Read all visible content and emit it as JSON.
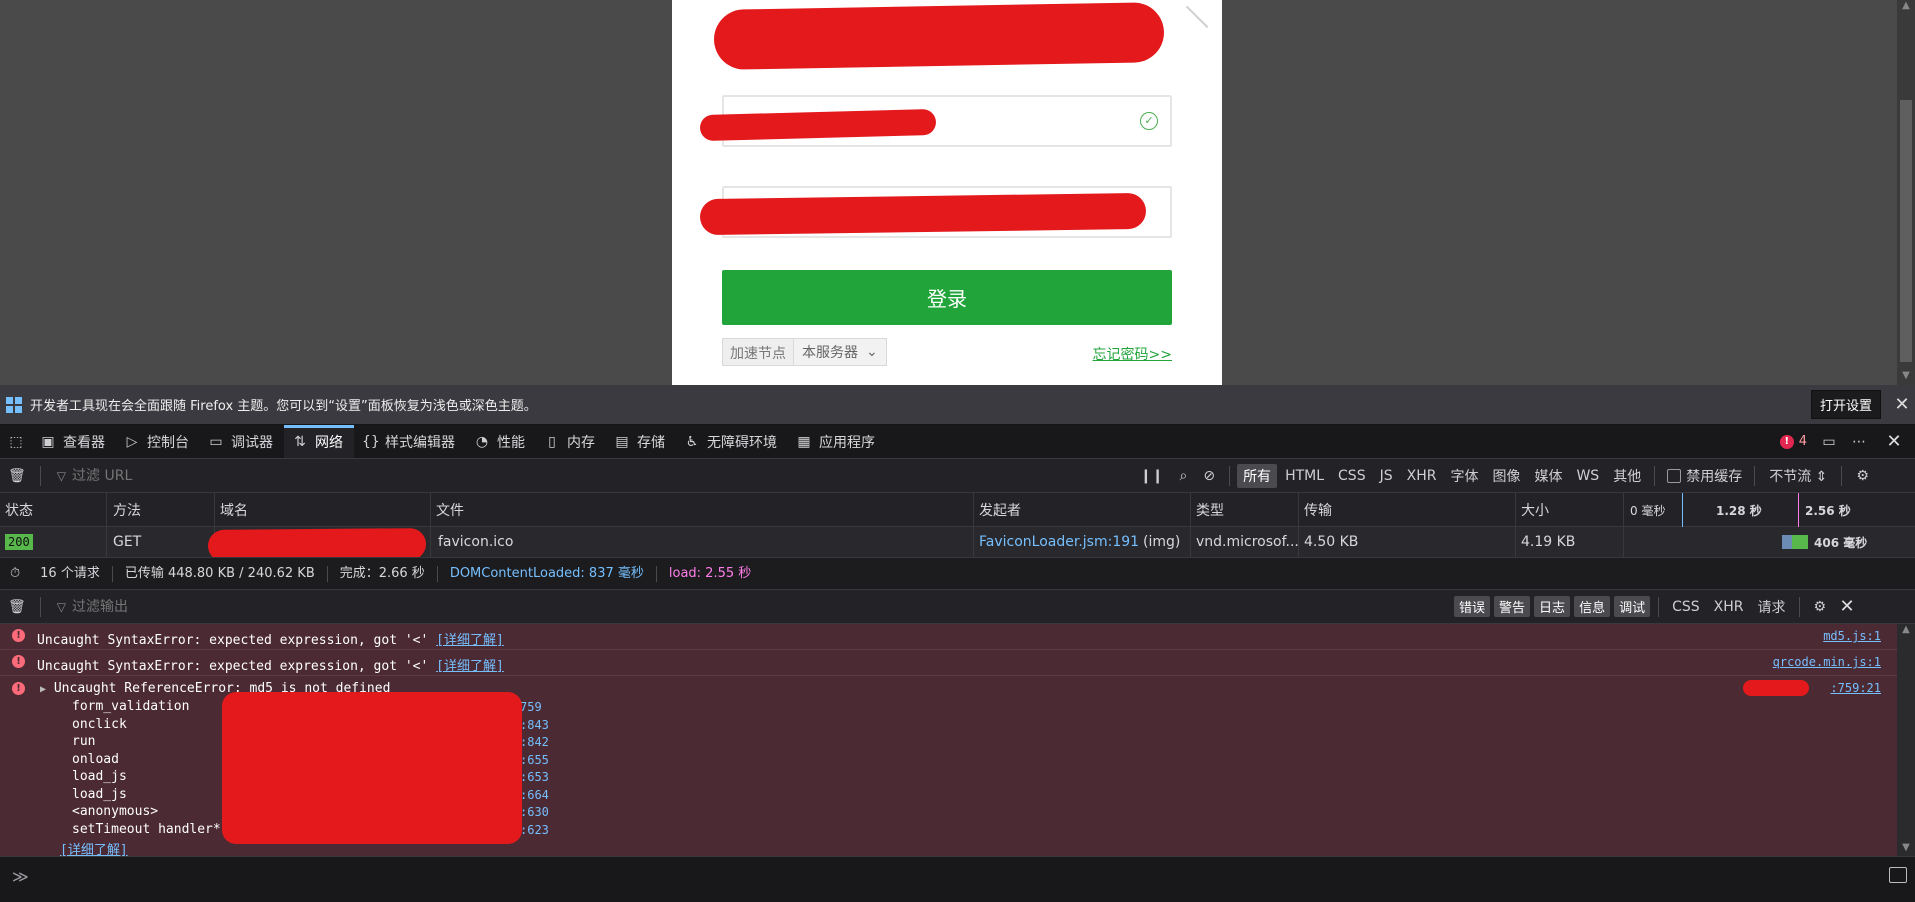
{
  "login": {
    "submit_label": "登录",
    "node_label": "加速节点",
    "node_value": "本服务器",
    "forgot_label": "忘记密码>>"
  },
  "notice": {
    "text": "开发者工具现在会全面跟随 Firefox 主题。您可以到“设置”面板恢复为浅色或深色主题。",
    "button": "打开设置"
  },
  "toolbox": {
    "tabs": [
      "查看器",
      "控制台",
      "调试器",
      "网络",
      "样式编辑器",
      "性能",
      "内存",
      "存储",
      "无障碍环境",
      "应用程序"
    ],
    "error_count": "4"
  },
  "network": {
    "filter_placeholder": "过滤 URL",
    "type_filters": [
      "所有",
      "HTML",
      "CSS",
      "JS",
      "XHR",
      "字体",
      "图像",
      "媒体",
      "WS",
      "其他"
    ],
    "disable_cache": "禁用缓存",
    "throttle": "不节流 ⇕",
    "columns": [
      "状态",
      "方法",
      "域名",
      "文件",
      "发起者",
      "类型",
      "传输",
      "大小"
    ],
    "timeline_ticks": [
      "0 毫秒",
      "1.28 秒",
      "2.56 秒"
    ],
    "row": {
      "status": "200",
      "method": "GET",
      "file": "favicon.ico",
      "initiator_link": "FaviconLoader.jsm:191",
      "initiator_type": "(img)",
      "type": "vnd.microsof...",
      "transferred": "4.50 KB",
      "size": "4.19 KB",
      "waterfall": "406 毫秒"
    },
    "summary": {
      "requests": "16 个请求",
      "transferred": "已传输 448.80 KB / 240.62 KB",
      "finish": "完成：2.66 秒",
      "dom": "DOMContentLoaded: 837 毫秒",
      "load": "load: 2.55 秒"
    }
  },
  "console": {
    "filter_placeholder": "过滤输出",
    "levels": [
      "错误",
      "警告",
      "日志",
      "信息",
      "调试"
    ],
    "filters": [
      "CSS",
      "XHR",
      "请求"
    ],
    "learn_more": "[详细了解]",
    "messages": [
      {
        "text": "Uncaught SyntaxError: expected expression, got '<'",
        "source": "md5.js:1"
      },
      {
        "text": "Uncaught SyntaxError: expected expression, got '<'",
        "source": "qrcode.min.js:1"
      },
      {
        "text": "Uncaught ReferenceError: md5 is not defined",
        "source": ":759:21"
      }
    ],
    "stack": [
      {
        "fn": "form_validation",
        "line": "759"
      },
      {
        "fn": "onclick",
        "line": ":843"
      },
      {
        "fn": "run",
        "line": ":842"
      },
      {
        "fn": "onload",
        "line": ":655"
      },
      {
        "fn": "load_js",
        "line": ":653"
      },
      {
        "fn": "load_js",
        "line": ":664"
      },
      {
        "fn": "<anonymous>",
        "line": ":630"
      },
      {
        "fn": "setTimeout handler*",
        "line": ":623"
      }
    ],
    "prompt": "≫"
  }
}
